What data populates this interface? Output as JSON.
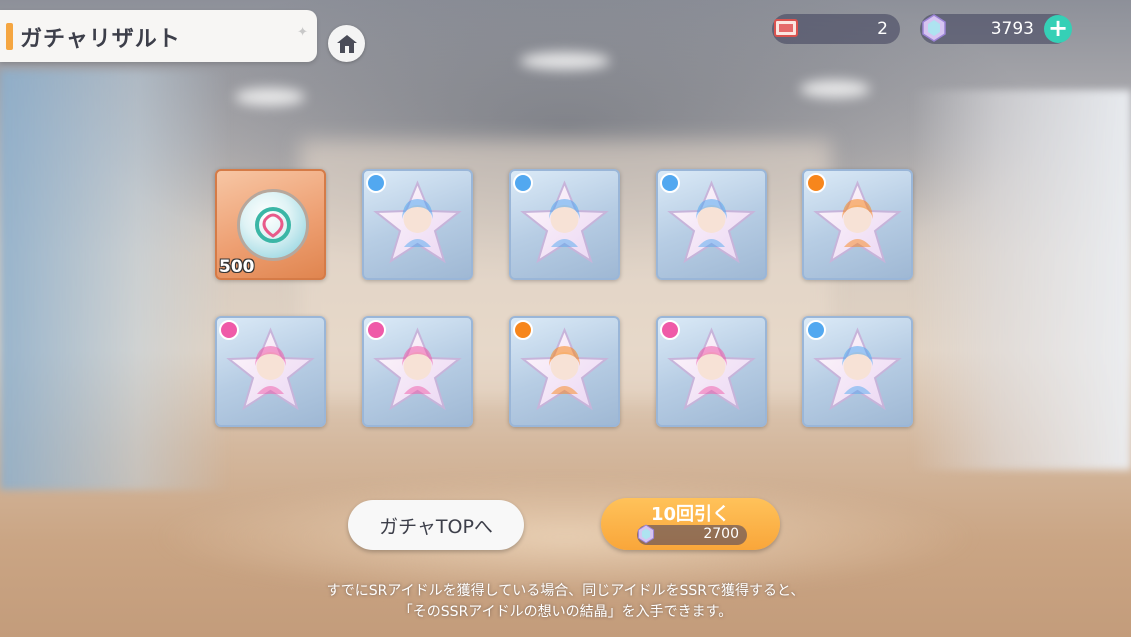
{
  "header": {
    "title": "ガチャリザルト",
    "home_icon": "home-icon",
    "tickets": {
      "icon": "gacha-ticket-icon",
      "value": "2"
    },
    "gems": {
      "icon": "jewel-icon",
      "value": "3793",
      "plus_label": "+"
    }
  },
  "results": [
    {
      "type": "item",
      "icon": "memory-piece-icon",
      "count": "500"
    },
    {
      "type": "idol",
      "attribute": "cool"
    },
    {
      "type": "idol",
      "attribute": "cool"
    },
    {
      "type": "idol",
      "attribute": "cool"
    },
    {
      "type": "idol",
      "attribute": "passion"
    },
    {
      "type": "idol",
      "attribute": "cute"
    },
    {
      "type": "idol",
      "attribute": "cute"
    },
    {
      "type": "idol",
      "attribute": "passion"
    },
    {
      "type": "idol",
      "attribute": "cute"
    },
    {
      "type": "idol",
      "attribute": "cool"
    }
  ],
  "buttons": {
    "gacha_top": "ガチャTOPへ",
    "pull_ten": "10回引く",
    "pull_cost": "2700"
  },
  "notice": {
    "line1": "すでにSRアイドルを獲得している場合、同じアイドルをSSRで獲得すると、",
    "line2": "「そのSSRアイドルの想いの結晶」を入手できます。"
  },
  "colors": {
    "accent": "#f5a641",
    "cool": "#52a8f0",
    "passion": "#f7861c",
    "cute": "#ef5aa8",
    "plus": "#35d0b6"
  }
}
